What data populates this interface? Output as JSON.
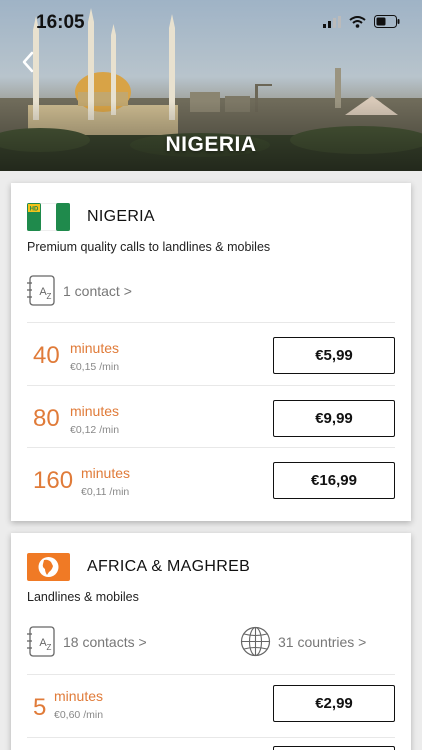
{
  "status": {
    "time": "16:05"
  },
  "header": {
    "title": "NIGERIA"
  },
  "colors": {
    "accent": "#e07b39",
    "flag_green": "#1f8a4c",
    "region_orange": "#f07a25"
  },
  "cards": [
    {
      "title": "NIGERIA",
      "icon": "nigeria-flag-hd",
      "subtitle": "Premium quality calls to landlines & mobiles",
      "contacts_label": "1 contact >",
      "offers": [
        {
          "amount": "40",
          "unit": "minutes",
          "rate": "€0,15 /min",
          "price": "€5,99"
        },
        {
          "amount": "80",
          "unit": "minutes",
          "rate": "€0,12 /min",
          "price": "€9,99"
        },
        {
          "amount": "160",
          "unit": "minutes",
          "rate": "€0,11 /min",
          "price": "€16,99"
        }
      ]
    },
    {
      "title": "AFRICA & MAGHREB",
      "icon": "africa-globe-icon",
      "subtitle": "Landlines & mobiles",
      "contacts_label": "18 contacts >",
      "countries_label": "31 countries >",
      "offers": [
        {
          "amount": "5",
          "unit": "minutes",
          "rate": "€0,60 /min",
          "price": "€2,99"
        }
      ]
    }
  ]
}
